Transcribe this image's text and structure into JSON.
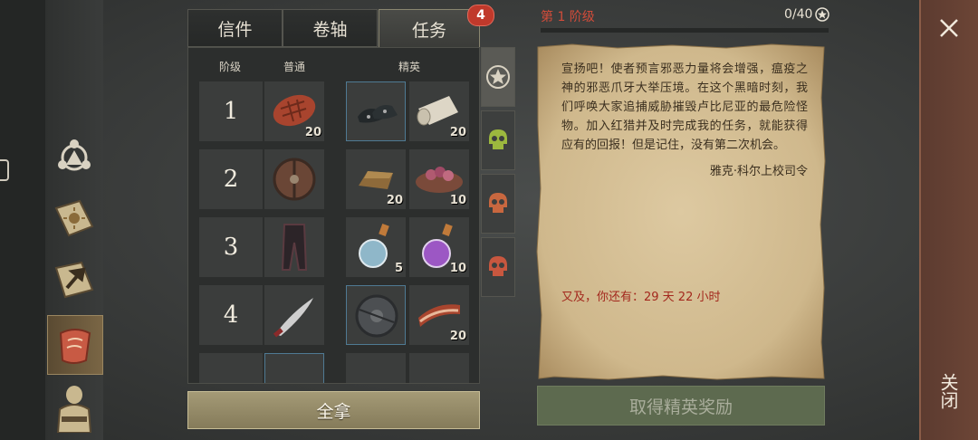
{
  "tabs": [
    {
      "label": "信件"
    },
    {
      "label": "卷轴"
    },
    {
      "label": "任务",
      "active": true
    }
  ],
  "badge": "4",
  "columns": {
    "tier": "阶级",
    "normal": "普通",
    "elite": "精英"
  },
  "rows": [
    {
      "tier": "1",
      "normal": {
        "icon": "steak-icon",
        "qty": "20"
      },
      "elite": [
        {
          "icon": "boots-icon",
          "qty": ""
        },
        {
          "icon": "cloth-roll-icon",
          "qty": "20"
        }
      ]
    },
    {
      "tier": "2",
      "normal": {
        "icon": "round-shield-icon",
        "qty": ""
      },
      "elite": [
        {
          "icon": "ingot-icon",
          "qty": "20"
        },
        {
          "icon": "meat-bowl-icon",
          "qty": "10"
        }
      ]
    },
    {
      "tier": "3",
      "normal": {
        "icon": "leather-pants-icon",
        "qty": ""
      },
      "elite": [
        {
          "icon": "potion-blue-icon",
          "qty": "5"
        },
        {
          "icon": "potion-purple-icon",
          "qty": "10"
        }
      ]
    },
    {
      "tier": "4",
      "normal": {
        "icon": "scimitar-icon",
        "qty": ""
      },
      "elite": [
        {
          "icon": "iron-shield-icon",
          "qty": ""
        },
        {
          "icon": "bacon-icon",
          "qty": "20"
        }
      ]
    }
  ],
  "take_all": "全拿",
  "stage": {
    "label": "第 1 阶级",
    "count": "0/40",
    "progress": 0
  },
  "letter": {
    "body": "宣扬吧！使者预言邪恶力量将会增强，瘟疫之神的邪恶爪牙大举压境。在这个黑暗时刻，我们呼唤大家追捕威胁摧毁卢比尼亚的最危险怪物。加入红猎并及时完成我的任务，就能获得应有的回报！但是记住，没有第二次机会。",
    "signature": "雅克·科尔上校司令",
    "countdown": "又及，你还有：29 天 22 小时"
  },
  "elite_reward_button": "取得精英奖励",
  "close_label": "关闭",
  "colors": {
    "accent_red": "#d24c3a",
    "skull_green": "#9cb83e",
    "skull_orange": "#c8673f"
  }
}
